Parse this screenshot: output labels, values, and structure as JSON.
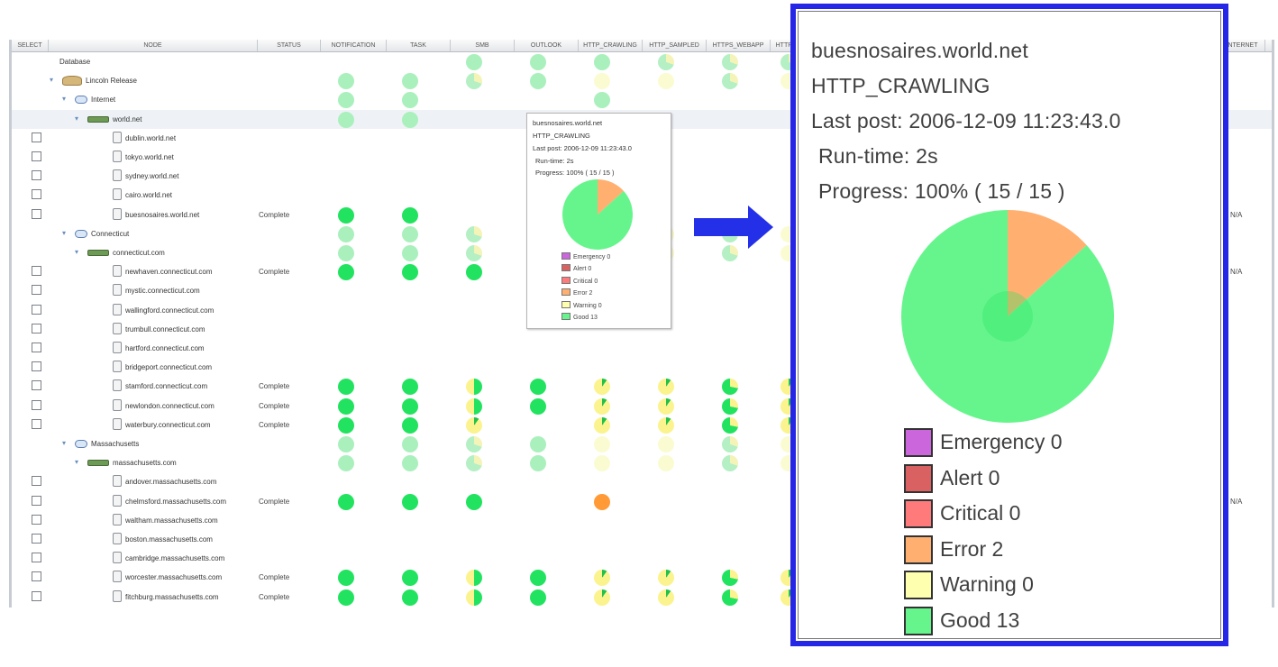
{
  "columns": [
    "SELECT",
    "NODE",
    "STATUS",
    "NOTIFICATION",
    "TASK",
    "SMB",
    "OUTLOOK",
    "HTTP_CRAWLING",
    "HTTP_SAMPLED",
    "HTTPS_WEBAPP",
    "HTTP_W",
    "INTERNET"
  ],
  "tree": [
    {
      "label": "Database",
      "status": ""
    },
    {
      "label": "Lincoln Release",
      "status": ""
    },
    {
      "label": "Internet",
      "status": ""
    },
    {
      "label": "world.net",
      "status": ""
    },
    {
      "label": "dublin.world.net",
      "status": ""
    },
    {
      "label": "tokyo.world.net",
      "status": ""
    },
    {
      "label": "sydney.world.net",
      "status": ""
    },
    {
      "label": "cairo.world.net",
      "status": ""
    },
    {
      "label": "buesnosaires.world.net",
      "status": "Complete",
      "na": "N/A"
    },
    {
      "label": "Connecticut",
      "status": ""
    },
    {
      "label": "connecticut.com",
      "status": ""
    },
    {
      "label": "newhaven.connecticut.com",
      "status": "Complete",
      "na": "N/A"
    },
    {
      "label": "mystic.connecticut.com",
      "status": ""
    },
    {
      "label": "wallingford.connecticut.com",
      "status": ""
    },
    {
      "label": "trumbull.connecticut.com",
      "status": ""
    },
    {
      "label": "hartford.connecticut.com",
      "status": ""
    },
    {
      "label": "bridgeport.connecticut.com",
      "status": ""
    },
    {
      "label": "stamford.connecticut.com",
      "status": "Complete"
    },
    {
      "label": "newlondon.connecticut.com",
      "status": "Complete"
    },
    {
      "label": "waterbury.connecticut.com",
      "status": "Complete"
    },
    {
      "label": "Massachusetts",
      "status": ""
    },
    {
      "label": "massachusetts.com",
      "status": ""
    },
    {
      "label": "andover.massachusetts.com",
      "status": ""
    },
    {
      "label": "chelmsford.massachusetts.com",
      "status": "Complete",
      "na": "N/A"
    },
    {
      "label": "waltham.massachusetts.com",
      "status": ""
    },
    {
      "label": "boston.massachusetts.com",
      "status": ""
    },
    {
      "label": "cambridge.massachusetts.com",
      "status": ""
    },
    {
      "label": "worcester.massachusetts.com",
      "status": "Complete"
    },
    {
      "label": "fitchburg.massachusetts.com",
      "status": "Complete"
    }
  ],
  "popup": {
    "host": "buesnosaires.world.net",
    "service": "HTTP_CRAWLING",
    "last_post": "Last post: 2006-12-09 11:23:43.0",
    "runtime": "Run-time: 2s",
    "progress": "Progress: 100% ( 15 / 15 )",
    "progress_fraction": 1.0,
    "slices": [
      {
        "label": "Emergency 0",
        "value": 0,
        "color": "#cc66dd"
      },
      {
        "label": "Alert 0",
        "value": 0,
        "color": "#d96161"
      },
      {
        "label": "Critical 0",
        "value": 0,
        "color": "#ff7b7b"
      },
      {
        "label": "Error 2",
        "value": 2,
        "color": "#ffb070"
      },
      {
        "label": "Warning 0",
        "value": 0,
        "color": "#ffffb0"
      },
      {
        "label": "Good 13",
        "value": 13,
        "color": "#66f58c"
      }
    ]
  },
  "small_popup": {
    "host": "buesnosaires.world.net",
    "service": "HTTP_CRAWLING",
    "last_post": "Last post: 2006-12-09 11:23:43.0",
    "runtime": "Run-time: 2s",
    "progress": "Progress: 100% ( 15 / 15 )"
  }
}
